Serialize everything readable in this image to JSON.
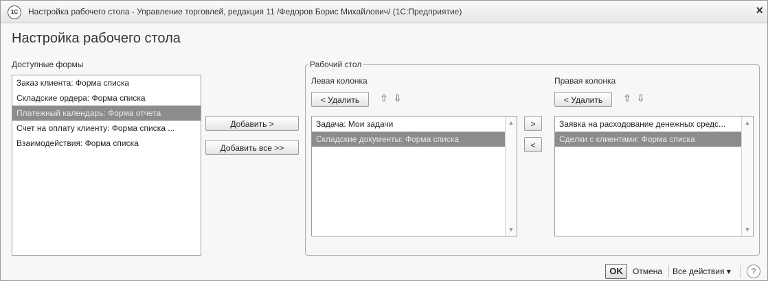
{
  "window": {
    "app_icon_text": "1С",
    "title": "Настройка рабочего стола - Управление торговлей, редакция 11 /Федоров Борис Михайлович/ (1С:Предприятие)",
    "close_glyph": "×"
  },
  "heading": "Настройка рабочего стола",
  "available": {
    "label": "Доступные формы",
    "items": [
      {
        "text": "Заказ клиента: Форма списка",
        "selected": false
      },
      {
        "text": "Складские ордера: Форма списка",
        "selected": false
      },
      {
        "text": "Платежный календарь: Форма отчета",
        "selected": true
      },
      {
        "text": "Счет на оплату клиенту: Форма списка ...",
        "selected": false
      },
      {
        "text": "Взаимодействия: Форма списка",
        "selected": false
      }
    ]
  },
  "add_buttons": {
    "add": "Добавить  >",
    "add_all": "Добавить все  >>"
  },
  "desktop": {
    "group_title": "Рабочий стол",
    "left": {
      "label": "Левая колонка",
      "delete": "< Удалить",
      "items": [
        {
          "text": "Задача: Мои задачи",
          "selected": false
        },
        {
          "text": "Складские документы: Форма списка",
          "selected": true
        }
      ]
    },
    "right": {
      "label": "Правая колонка",
      "delete": "< Удалить",
      "items": [
        {
          "text": "Заявка на расходование денежных средс...",
          "selected": false
        },
        {
          "text": "Сделки с клиентами: Форма списка",
          "selected": true
        }
      ]
    },
    "move_right": ">",
    "move_left": "<"
  },
  "icons": {
    "up": "⇧",
    "down": "⇩",
    "scroll_up": "▲",
    "scroll_down": "▼"
  },
  "footer": {
    "ok": "OK",
    "cancel": "Отмена",
    "all_actions": "Все действия",
    "dropdown_glyph": "▾",
    "help": "?"
  },
  "colors": {
    "selection": "#8c8c8c",
    "window_bg": "#f7f7f7"
  }
}
